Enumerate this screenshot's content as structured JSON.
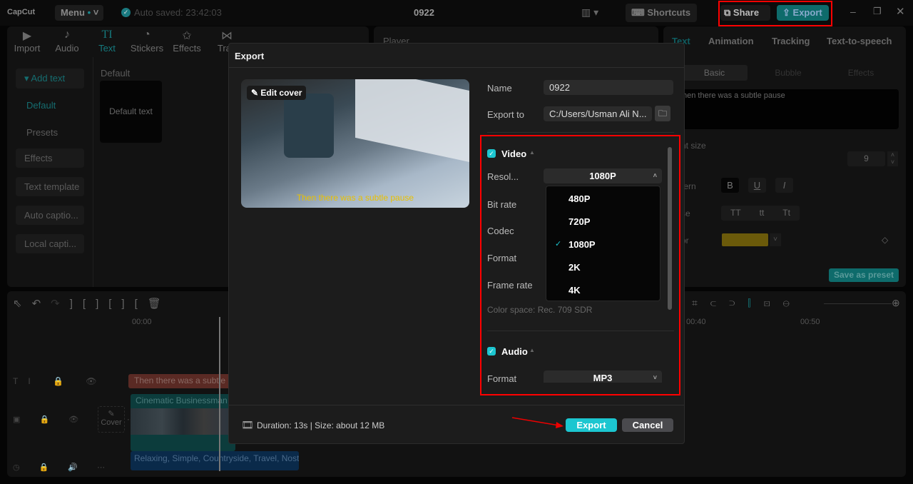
{
  "topbar": {
    "logo": "CapCut",
    "menu": "Menu",
    "autosave": "Auto saved: 23:42:03",
    "title": "0922",
    "shortcuts": "Shortcuts",
    "share": "Share",
    "export": "Export"
  },
  "toolbar": {
    "tabs": [
      {
        "label": "Import",
        "icon": "import-icon"
      },
      {
        "label": "Audio",
        "icon": "audio-icon"
      },
      {
        "label": "Text",
        "icon": "text-icon",
        "active": true
      },
      {
        "label": "Stickers",
        "icon": "stickers-icon"
      },
      {
        "label": "Effects",
        "icon": "effects-icon"
      },
      {
        "label": "Tran",
        "icon": "transitions-icon"
      }
    ]
  },
  "sidebar": {
    "items": [
      "Add text",
      "Default",
      "Presets",
      "Effects",
      "Text template",
      "Auto captio...",
      "Local capti..."
    ]
  },
  "library": {
    "section": "Default",
    "card": "Default text"
  },
  "player": {
    "title": "Player"
  },
  "inspector": {
    "tabs": [
      "Text",
      "Animation",
      "Tracking",
      "Text-to-speech"
    ],
    "subtabs": [
      "Basic",
      "Bubble",
      "Effects"
    ],
    "text_value": "hen there was a subtle pause",
    "font_size_label": "nt size",
    "font_size": "9",
    "pattern_label": "tern",
    "case_label": "se",
    "color_label": "or",
    "case_options": [
      "TT",
      "tt",
      "Tt"
    ],
    "pattern_options": [
      "B",
      "U",
      "I"
    ],
    "color": "#6b5a0a",
    "save_preset": "Save as preset"
  },
  "timeline": {
    "ticks": [
      "00:00",
      "00:40",
      "00:50"
    ],
    "text_clip": "Then there was a subtle p",
    "video_clip": "Cinematic Businessman U",
    "audio_clip": "Relaxing, Simple, Countryside, Travel, Nostal",
    "cover": "Cover"
  },
  "dialog": {
    "title": "Export",
    "edit_cover": "Edit cover",
    "cover_caption": "Then there was a subtle pause",
    "name_label": "Name",
    "name_value": "0922",
    "export_to_label": "Export to",
    "export_to_value": "C:/Users/Usman Ali N...",
    "video": {
      "label": "Video",
      "checked": true,
      "resolution_label": "Resol...",
      "resolution_value": "1080P",
      "bitrate_label": "Bit rate",
      "codec_label": "Codec",
      "format_label": "Format",
      "framerate_label": "Frame rate",
      "color_space": "Color space: Rec. 709 SDR",
      "resolution_options": [
        "480P",
        "720P",
        "1080P",
        "2K",
        "4K"
      ],
      "selected": "1080P"
    },
    "audio": {
      "label": "Audio",
      "checked": true,
      "format_label": "Format",
      "format_value": "MP3"
    },
    "footer_info": "Duration: 13s | Size: about 12 MB",
    "export_button": "Export",
    "cancel_button": "Cancel"
  },
  "colors": {
    "accent": "#1cc6d0",
    "highlight": "#ff0000"
  }
}
